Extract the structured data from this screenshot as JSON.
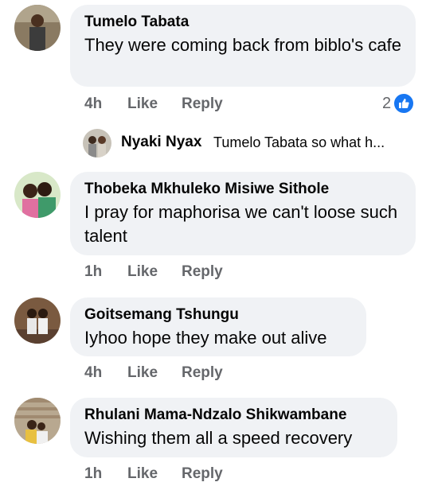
{
  "comments": [
    {
      "name": "Tumelo Tabata",
      "text": "They were coming back from biblo's cafe",
      "time": "4h",
      "like": "Like",
      "reply": "Reply",
      "reactions": "2",
      "reaction_icon": "thumbs-up-icon"
    },
    {
      "name": "Thobeka Mkhuleko Misiwe Sithole",
      "text": "I pray for maphorisa we can't loose such talent",
      "time": "1h",
      "like": "Like",
      "reply": "Reply"
    },
    {
      "name": "Goitsemang Tshungu",
      "text": "Iyhoo hope they make out alive",
      "time": "4h",
      "like": "Like",
      "reply": "Reply"
    },
    {
      "name": "Rhulani Mama-Ndzalo Shikwambane",
      "text": "Wishing them all a speed recovery",
      "time": "1h",
      "like": "Like",
      "reply": "Reply"
    }
  ],
  "reply_preview": {
    "name": "Nyaki Nyax",
    "text": "Tumelo Tabata  so what h..."
  },
  "colors": {
    "bubble": "#f0f2f5",
    "meta_text": "#65676b",
    "like_blue": "#1877f2"
  }
}
